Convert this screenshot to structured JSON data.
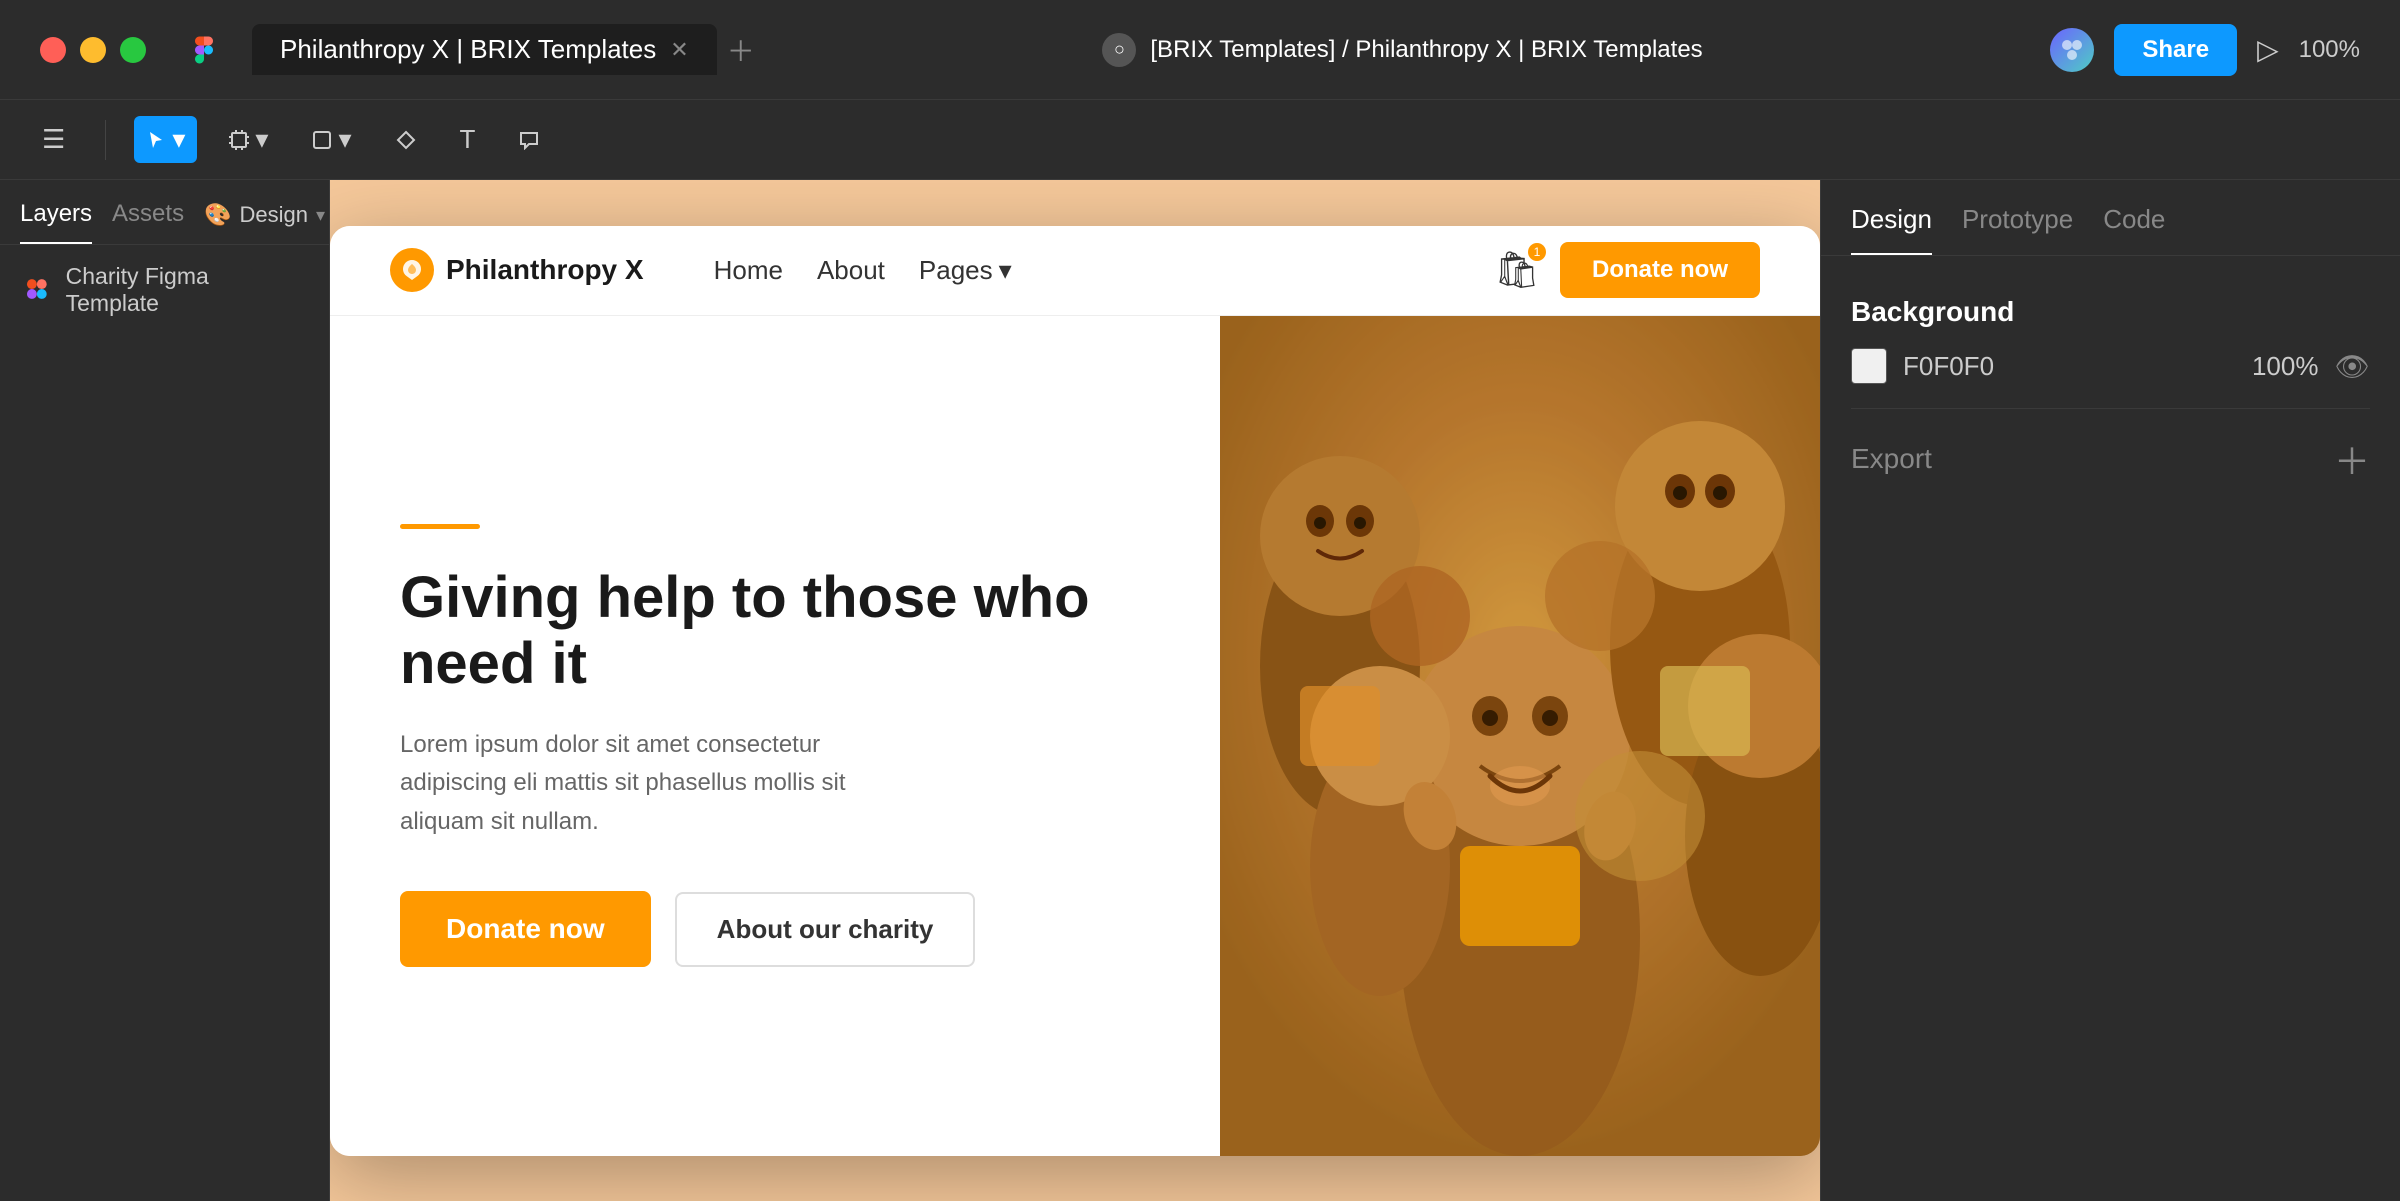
{
  "window": {
    "tab_title": "Philanthropy X | BRIX Templates",
    "breadcrumb_user": "[BRIX Templates]",
    "breadcrumb_sep": "/",
    "breadcrumb_project": "Philanthropy X | BRIX Templates"
  },
  "topbar": {
    "share_label": "Share",
    "zoom_label": "100%"
  },
  "toolbar": {
    "menu_icon": "☰",
    "select_icon": "▲",
    "frame_icon": "#",
    "shape_icon": "□",
    "pen_icon": "✒",
    "text_icon": "T",
    "comment_icon": "○"
  },
  "left_panel": {
    "tabs": [
      {
        "label": "Layers",
        "active": true
      },
      {
        "label": "Assets",
        "active": false
      }
    ],
    "design_label": "Design",
    "layer_item": {
      "label": "Charity Figma Template"
    }
  },
  "site": {
    "logo_text": "Philanthropy X",
    "nav_links": [
      "Home",
      "About",
      "Pages"
    ],
    "pages_dropdown": "▾",
    "donate_nav": "Donate now",
    "hero": {
      "accent": "",
      "title": "Giving help to those who need it",
      "subtitle": "Lorem ipsum dolor sit amet consectetur adipiscing eli mattis sit phasellus mollis sit aliquam sit nullam.",
      "btn_donate": "Donate now",
      "btn_charity": "About our charity"
    }
  },
  "right_panel": {
    "tabs": [
      "Design",
      "Prototype",
      "Code"
    ],
    "active_tab": "Design",
    "background_label": "Background",
    "bg_color": "F0F0F0",
    "bg_opacity": "100%",
    "export_label": "Export"
  }
}
